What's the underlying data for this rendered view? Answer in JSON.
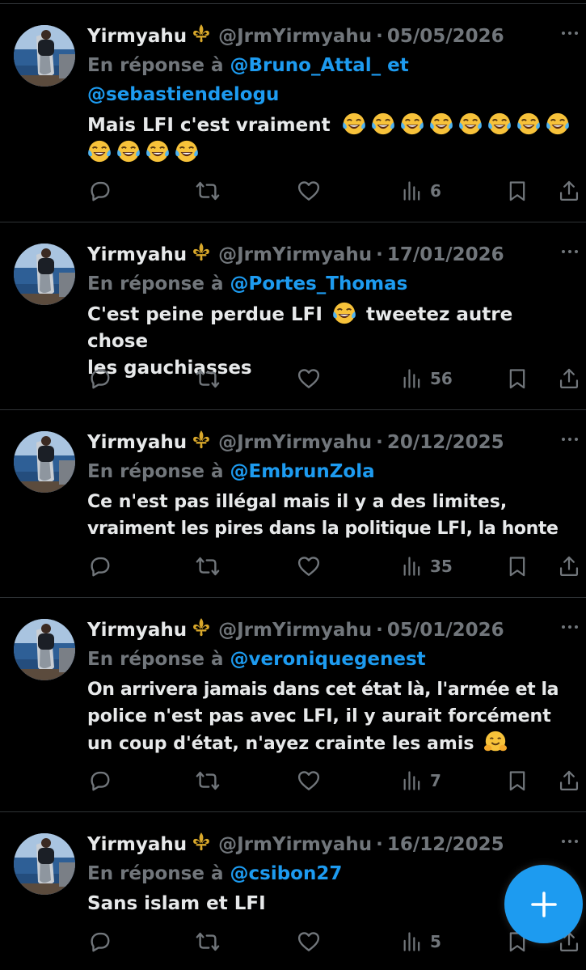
{
  "feed": {
    "tweets": [
      {
        "name": "Yirmyahu",
        "handle": "@JrmYirmyahu",
        "separator": "·",
        "date": "05/05/2026",
        "reply_prefix": "En réponse à",
        "mentions": [
          "@Bruno_Attal_",
          "@sebastiendelogu"
        ],
        "reply_joiner": "et",
        "text_line1": "Mais LFI c'est vraiment",
        "emoji_count_line1": 8,
        "emoji_count_line2": 4,
        "emoji": "face-with-tears-of-joy",
        "views": "6"
      },
      {
        "name": "Yirmyahu",
        "handle": "@JrmYirmyahu",
        "separator": "·",
        "date": "17/01/2026",
        "reply_prefix": "En réponse à",
        "mentions": [
          "@Portes_Thomas"
        ],
        "text_before_emoji": "C'est peine perdue LFI",
        "text_after_emoji": "tweetez autre chose",
        "text_line2": "les gauchiasses",
        "emoji": "face-with-tears-of-joy",
        "views": "56"
      },
      {
        "name": "Yirmyahu",
        "handle": "@JrmYirmyahu",
        "separator": "·",
        "date": "20/12/2025",
        "reply_prefix": "En réponse à",
        "mentions": [
          "@EmbrunZola"
        ],
        "text_line1": "Ce n'est pas illégal mais il y a des limites,",
        "text_line2": "vraiment les pires dans la politique LFI, la honte",
        "views": "35"
      },
      {
        "name": "Yirmyahu",
        "handle": "@JrmYirmyahu",
        "separator": "·",
        "date": "05/01/2026",
        "reply_prefix": "En réponse à",
        "mentions": [
          "@veroniquegenest"
        ],
        "text_line1": "On arrivera jamais dans cet état là, l'armée et la",
        "text_line2": "police n'est pas avec LFI, il y aurait forcément",
        "text_line3": "un coup d'état, n'ayez crainte les amis",
        "emoji": "hugging-face",
        "views": "7"
      },
      {
        "name": "Yirmyahu",
        "handle": "@JrmYirmyahu",
        "separator": "·",
        "date": "16/12/2025",
        "reply_prefix": "En réponse à",
        "mentions": [
          "@csibon27"
        ],
        "text_line1": "Sans islam et LFI",
        "views": "5"
      }
    ]
  },
  "icons": {
    "verified_badge": "fleur-de-lis-icon",
    "reply": "reply-icon",
    "retweet": "retweet-icon",
    "like": "heart-icon",
    "views": "views-chart-icon",
    "bookmark": "bookmark-icon",
    "share": "share-icon",
    "compose": "plus-icon"
  },
  "colors": {
    "background": "#000000",
    "text": "#e7e9ea",
    "muted": "#71767b",
    "accent": "#1d9bf0",
    "divider": "#2f3336"
  }
}
